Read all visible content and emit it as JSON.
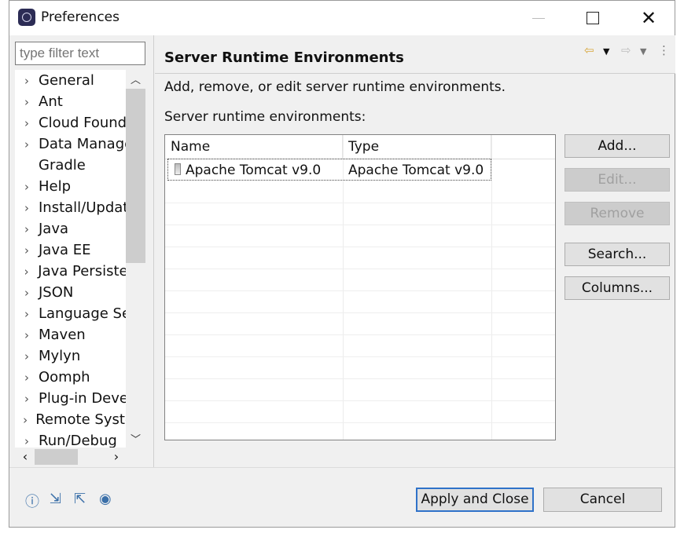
{
  "window": {
    "title": "Preferences"
  },
  "filter": {
    "placeholder": "type filter text"
  },
  "tree": [
    {
      "label": "General",
      "expandable": true
    },
    {
      "label": "Ant",
      "expandable": true
    },
    {
      "label": "Cloud Found",
      "expandable": true
    },
    {
      "label": "Data Manage",
      "expandable": true
    },
    {
      "label": "Gradle",
      "expandable": false
    },
    {
      "label": "Help",
      "expandable": true
    },
    {
      "label": "Install/Updat",
      "expandable": true
    },
    {
      "label": "Java",
      "expandable": true
    },
    {
      "label": "Java EE",
      "expandable": true
    },
    {
      "label": "Java Persister",
      "expandable": true
    },
    {
      "label": "JSON",
      "expandable": true
    },
    {
      "label": "Language Se",
      "expandable": true
    },
    {
      "label": "Maven",
      "expandable": true
    },
    {
      "label": "Mylyn",
      "expandable": true
    },
    {
      "label": "Oomph",
      "expandable": true
    },
    {
      "label": "Plug-in Deve",
      "expandable": true
    },
    {
      "label": "Remote Syste",
      "expandable": true
    },
    {
      "label": "Run/Debug",
      "expandable": true
    }
  ],
  "page": {
    "title": "Server Runtime Environments",
    "description": "Add, remove, or edit server runtime environments.",
    "list_label": "Server runtime environments:",
    "columns": [
      "Name",
      "Type"
    ],
    "rows": [
      {
        "name": "Apache Tomcat v9.0",
        "type": "Apache Tomcat v9.0",
        "selected": true
      }
    ],
    "buttons": {
      "add": "Add...",
      "edit": "Edit...",
      "remove": "Remove",
      "search": "Search...",
      "columns": "Columns..."
    }
  },
  "footer": {
    "apply_close": "Apply and Close",
    "cancel": "Cancel"
  },
  "icons": {
    "back": "arrow-left-icon",
    "forward": "arrow-right-icon",
    "menu": "view-menu-icon",
    "help": "help-icon",
    "import": "import-icon",
    "export": "export-icon",
    "record": "record-icon"
  },
  "colors": {
    "default_button_border": "#2f72c9",
    "back_arrow": "#d8a63a"
  }
}
